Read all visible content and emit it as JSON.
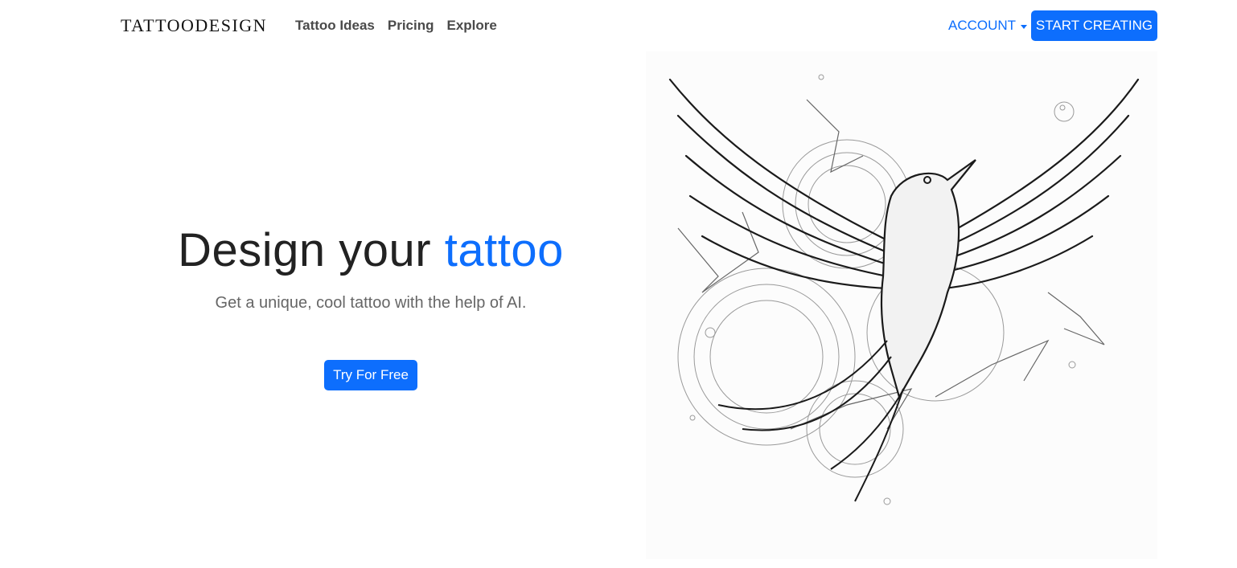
{
  "navbar": {
    "brand": "TATTOODESIGN",
    "links": [
      "Tattoo Ideas",
      "Pricing",
      "Explore"
    ],
    "account_label": "ACCOUNT",
    "start_label": "START CREATING"
  },
  "hero": {
    "headline_prefix": "Design your",
    "headline_accent": "tattoo",
    "subtitle": "Get a unique, cool tattoo with the help of AI.",
    "cta_label": "Try For Free"
  },
  "colors": {
    "accent": "#0d6efd",
    "text_dark": "#222222",
    "text_muted": "#666666"
  },
  "icons": {
    "account_dropdown": "caret-down-icon"
  }
}
